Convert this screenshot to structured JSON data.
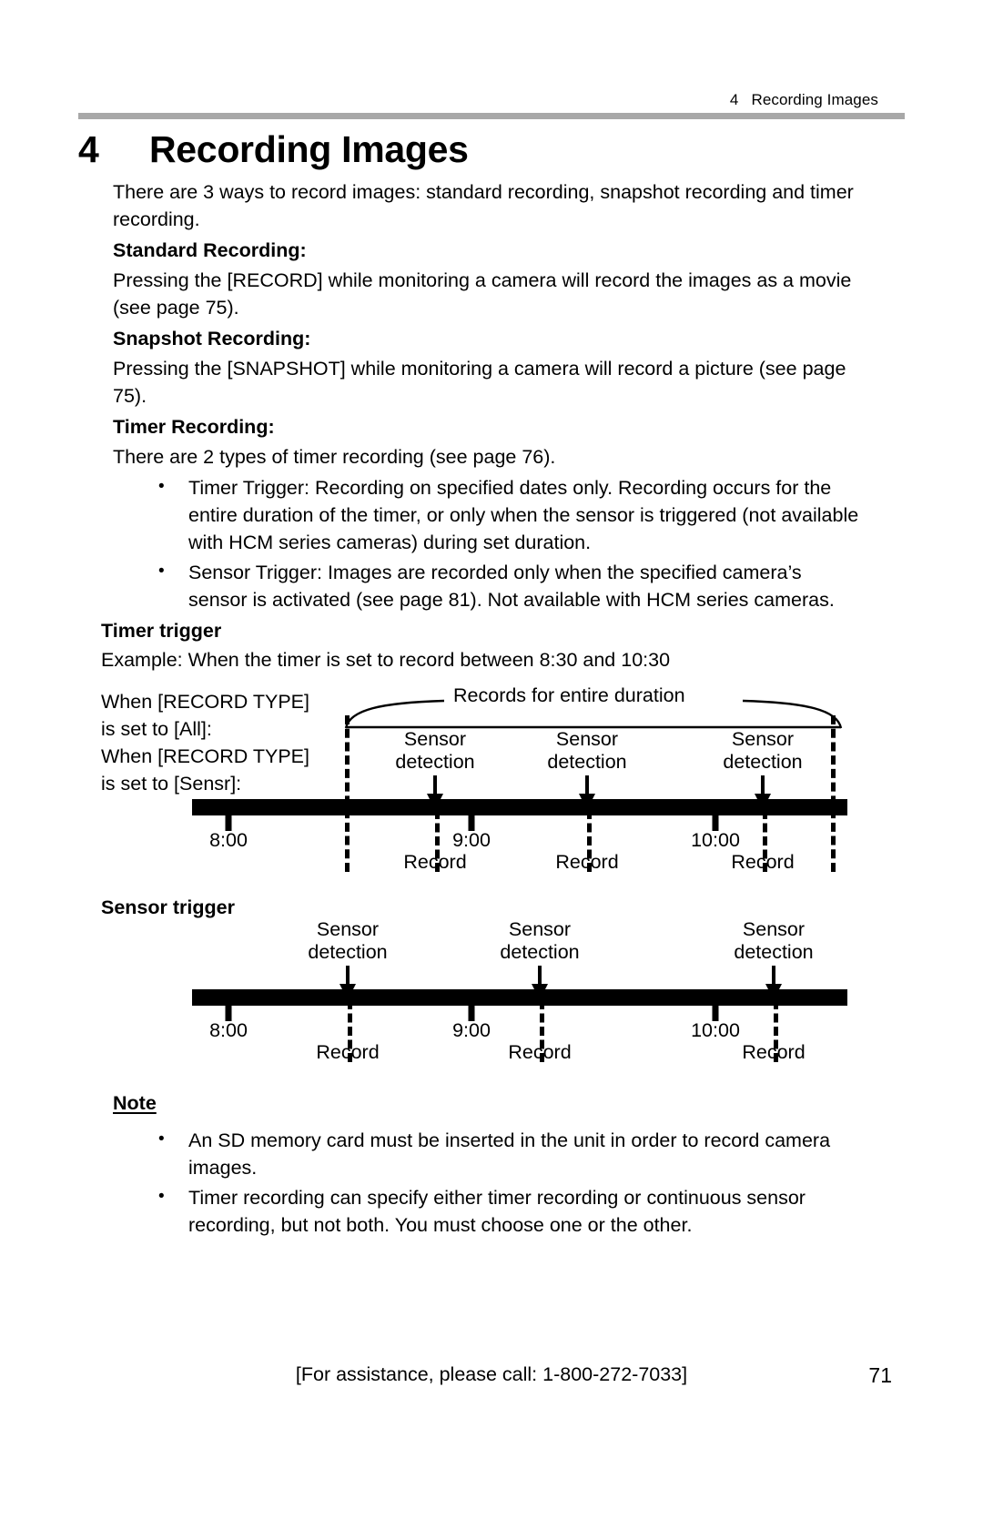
{
  "header": {
    "chapter_number": "4",
    "chapter_label": "Recording Images"
  },
  "title": {
    "number": "4",
    "text": "Recording Images"
  },
  "intro": {
    "paragraph": "There are 3 ways to record images: standard recording, snapshot recording and timer recording."
  },
  "sections": [
    {
      "heading": "Standard Recording:",
      "body": "Pressing the [RECORD] while monitoring a camera will record the images as a movie (see page 75)."
    },
    {
      "heading": "Snapshot Recording:",
      "body": "Pressing the [SNAPSHOT] while monitoring a camera will record a picture (see page 75)."
    },
    {
      "heading": "Timer Recording:",
      "body": "There are 2 types of timer recording (see page 76)."
    }
  ],
  "timer_bullets": [
    "Timer Trigger: Recording on specified dates only. Recording occurs for the entire duration of the timer, or only when the sensor is triggered (not available with HCM series cameras) during set duration.",
    "Sensor Trigger: Images are recorded only when the specified camera’s sensor is activated (see page 81). Not available with HCM series cameras."
  ],
  "timer_trigger": {
    "heading": "Timer trigger",
    "example": "Example: When the timer is set to record between 8:30 and 10:30",
    "record_type_all_line1": "When [RECORD TYPE]",
    "record_type_all_line2": "is set to [All]:",
    "record_type_sensr_line1": "When [RECORD TYPE]",
    "record_type_sensr_line2": "is set to [Sensr]:",
    "duration_caption": "Records for entire duration",
    "sensor_labels": [
      {
        "line1": "Sensor",
        "line2": "detection"
      },
      {
        "line1": "Sensor",
        "line2": "detection"
      },
      {
        "line1": "Sensor",
        "line2": "detection"
      }
    ],
    "time_labels": [
      "8:00",
      "9:00",
      "10:00"
    ],
    "record_labels": [
      "Record",
      "Record",
      "Record"
    ]
  },
  "sensor_trigger": {
    "heading": "Sensor trigger",
    "sensor_labels": [
      {
        "line1": "Sensor",
        "line2": "detection"
      },
      {
        "line1": "Sensor",
        "line2": "detection"
      },
      {
        "line1": "Sensor",
        "line2": "detection"
      }
    ],
    "time_labels": [
      "8:00",
      "9:00",
      "10:00"
    ],
    "record_labels": [
      "Record",
      "Record",
      "Record"
    ]
  },
  "note": {
    "heading": "Note",
    "items": [
      "An SD memory card must be inserted in the unit in order to record camera images.",
      "Timer recording can specify either timer recording or continuous sensor recording, but not both. You must choose one or the other."
    ]
  },
  "footer": {
    "assistance": "[For assistance, please call: 1-800-272-7033]",
    "page_number": "71"
  },
  "bullet_glyph": "•",
  "colors": {
    "rule": "#a8a8a8",
    "text": "#000000",
    "bar": "#000000"
  }
}
